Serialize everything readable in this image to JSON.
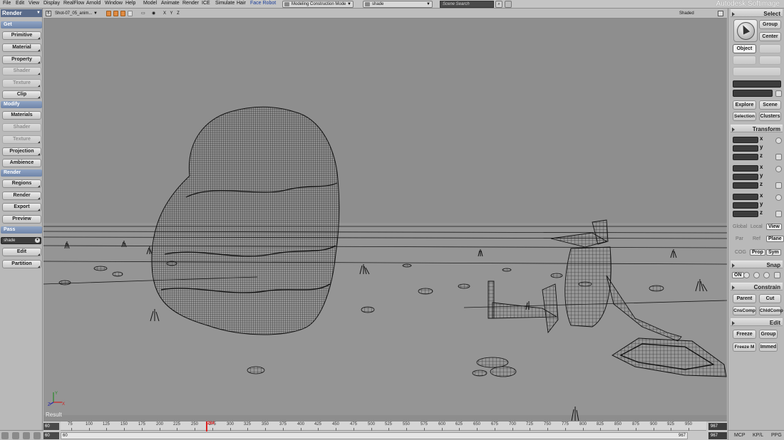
{
  "menubar": {
    "items": [
      "File",
      "Edit",
      "View",
      "Display",
      "RealFlow",
      "Arnold",
      "Window",
      "Help",
      "Model",
      "Animate",
      "Render",
      "ICE",
      "Simulate",
      "Hair",
      "Face Robot"
    ],
    "construction_mode": "Modeling Construction Mode",
    "pass_select": "shade",
    "search_placeholder": "Scene Search",
    "brand": "Autodesk Softimage"
  },
  "left_panel": {
    "toolbar_title": "Render",
    "get_header": "Get",
    "get_buttons": [
      "Primitive",
      "Material",
      "Property",
      "Shader",
      "Texture",
      "Clip"
    ],
    "get_disabled": [
      false,
      false,
      false,
      true,
      true,
      false
    ],
    "modify_header": "Modify",
    "modify_buttons": [
      "Materials",
      "Shader",
      "Texture",
      "Projection",
      "Ambience"
    ],
    "modify_disabled": [
      false,
      true,
      true,
      false,
      false
    ],
    "render_header": "Render",
    "render_buttons": [
      "Regions",
      "Render",
      "Export",
      "Preview"
    ],
    "pass_header": "Pass",
    "pass_value": "shade",
    "pass_buttons": [
      "Edit",
      "Partition"
    ]
  },
  "viewport": {
    "camera": "Shot-07_05_anim...",
    "axes_label": "X Y Z",
    "display_mode": "Shaded",
    "result_label": "Result",
    "axis_x": "X",
    "axis_z": "Z",
    "axis_y": "Y"
  },
  "timeline": {
    "ticks": [
      "75",
      "100",
      "125",
      "150",
      "175",
      "200",
      "225",
      "250",
      "275",
      "300",
      "325",
      "350",
      "375",
      "400",
      "425",
      "450",
      "475",
      "500",
      "525",
      "550",
      "575",
      "600",
      "625",
      "650",
      "675",
      "700",
      "725",
      "750",
      "775",
      "800",
      "825",
      "850",
      "875",
      "900",
      "925",
      "950"
    ],
    "start_field": "60",
    "start_field2": "60",
    "range_start": "60",
    "range_end": "967",
    "end_field": "967",
    "end_field2": "967",
    "current_frame": "264",
    "current_fraction": 0.225
  },
  "right_panel": {
    "select_header": "Select",
    "group_button": "Group",
    "center_button": "Center",
    "object_button": "Object",
    "explore_button": "Explore",
    "scene_button": "Scene",
    "selection_button": "Selection",
    "clusters_button": "Clusters",
    "transform_header": "Transform",
    "axis_labels": [
      "x",
      "y",
      "z"
    ],
    "modes_row1": [
      "Global",
      "Local",
      "View"
    ],
    "modes_row2": [
      "Par",
      "Ref",
      "Plane"
    ],
    "modes_row3": [
      "COG",
      "Prop",
      "Sym"
    ],
    "snap_header": "Snap",
    "snap_on": "ON",
    "constrain_header": "Constrain",
    "parent_button": "Parent",
    "cut_button": "Cut",
    "cnscomp_button": "CnsComp",
    "childcomp_button": "ChldComp",
    "edit_header": "Edit",
    "freeze_button": "Freeze",
    "group2_button": "Group",
    "freezem_button": "Freeze M",
    "immed_button": "Immed",
    "bottom": [
      "MCP",
      "KP/L",
      "PPG"
    ]
  },
  "colors": {
    "viewport_bg": "#8e8e8e",
    "wireframe": "#1a1a1a",
    "header_blue": "#6f85a9",
    "playhead": "#dd2222"
  }
}
